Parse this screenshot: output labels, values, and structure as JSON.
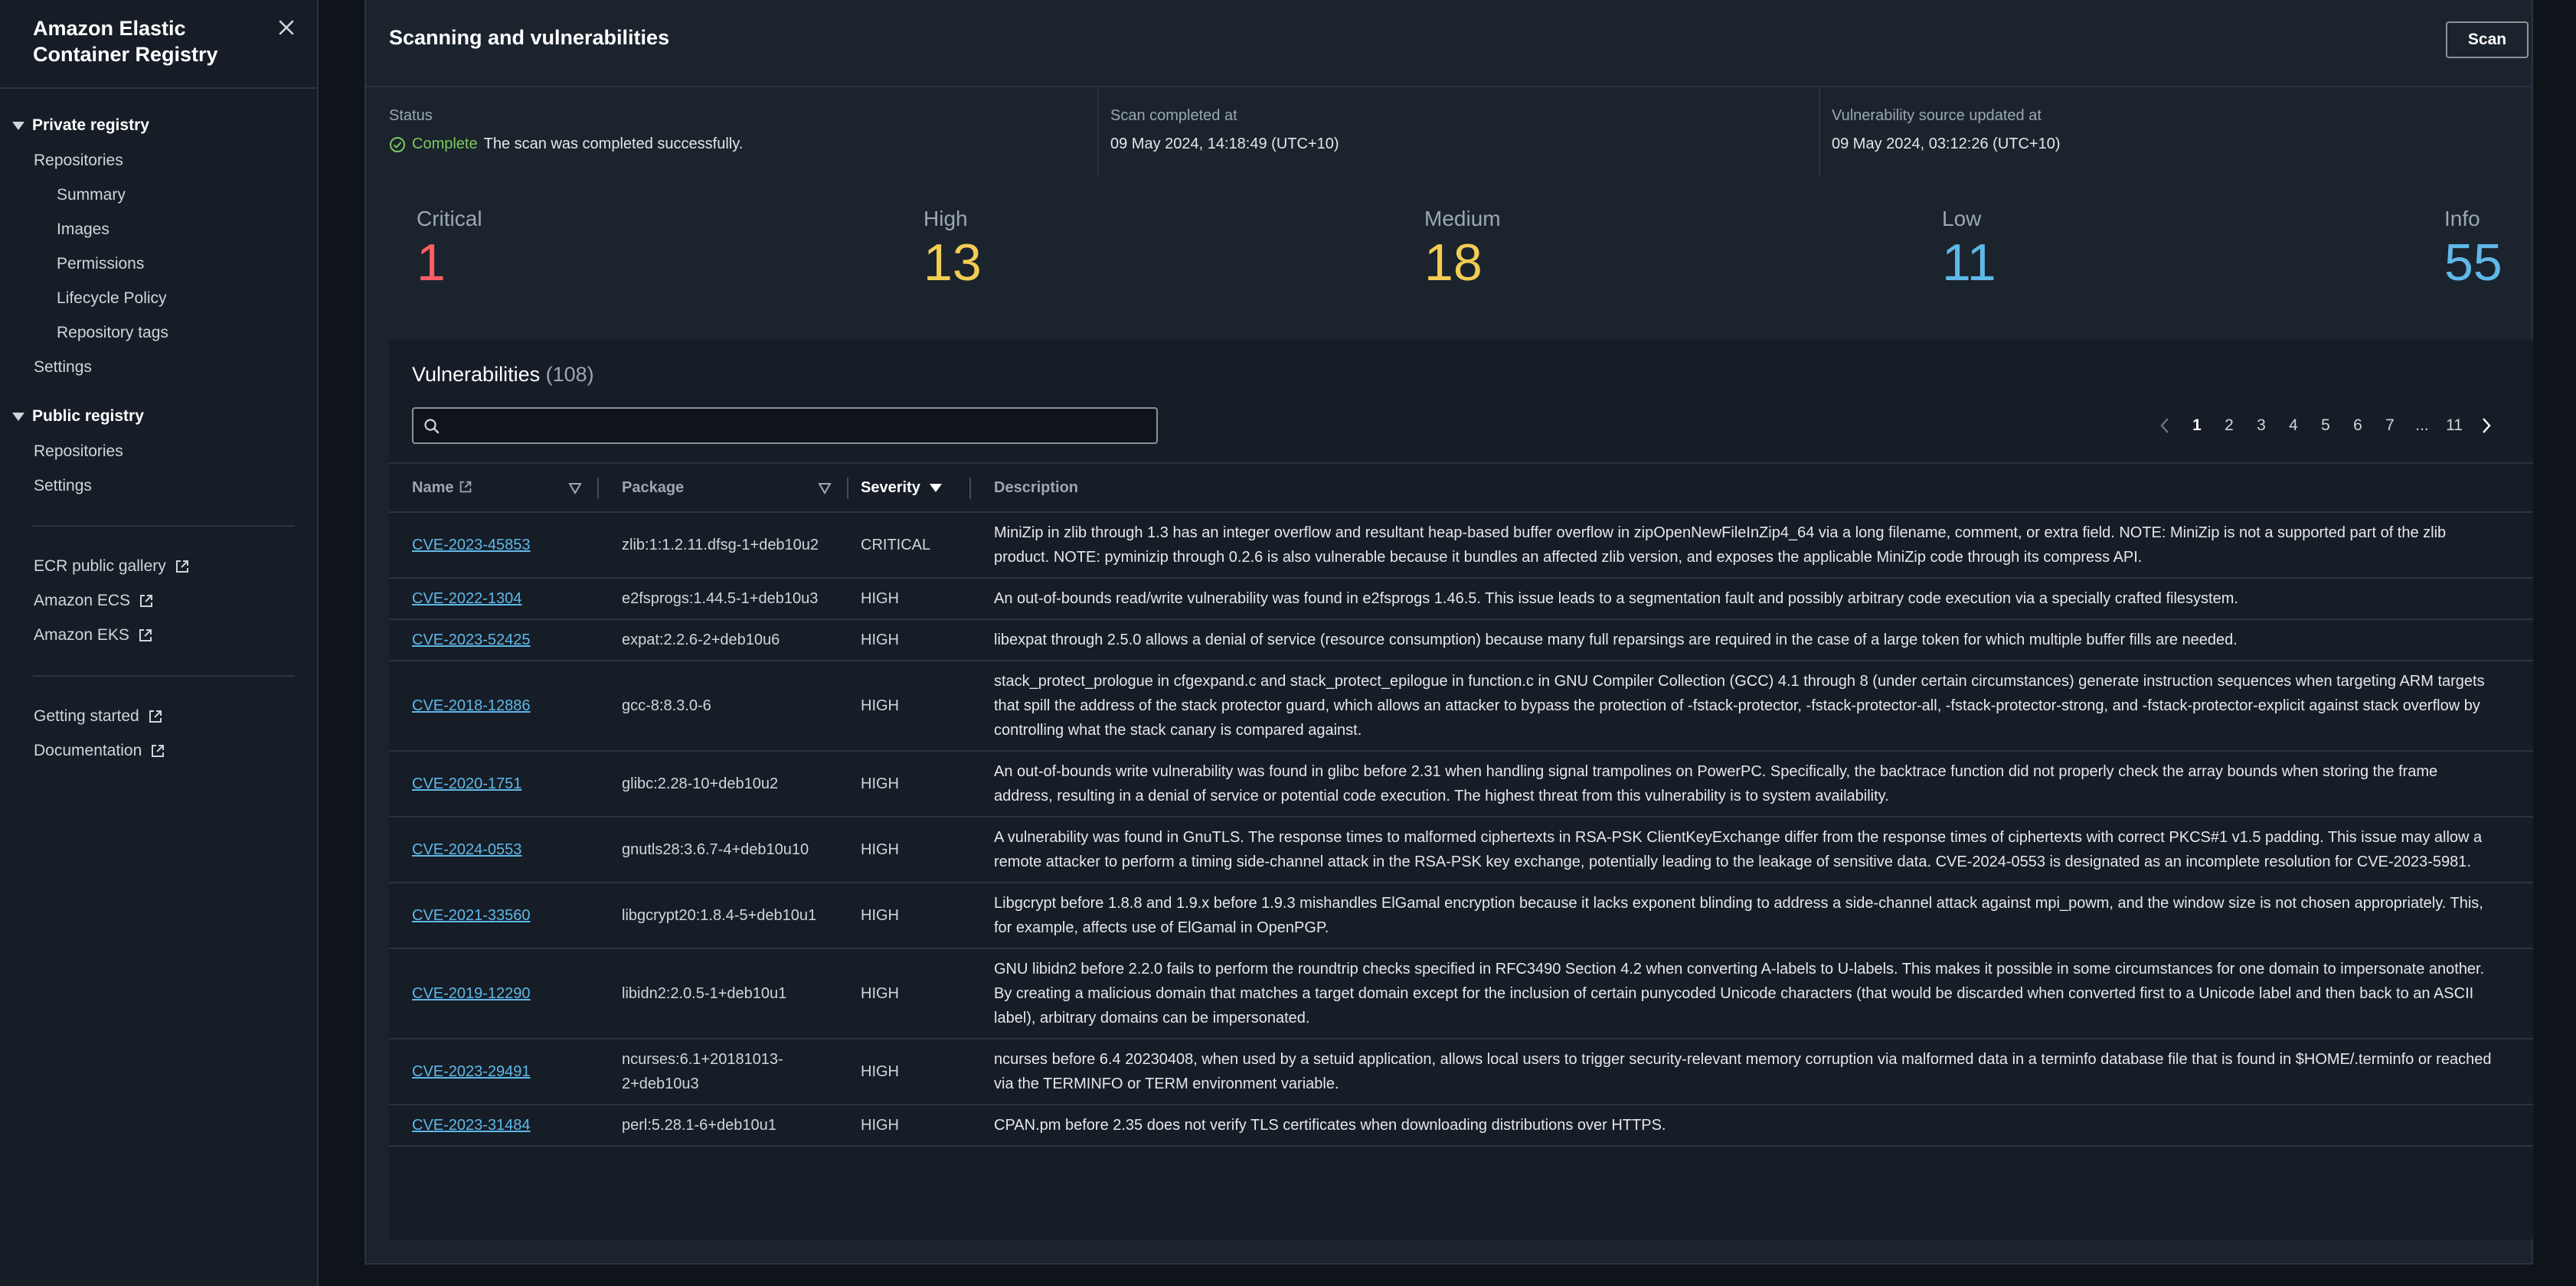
{
  "sidebar": {
    "title": "Amazon Elastic Container Registry",
    "private_registry": {
      "label": "Private registry",
      "items": [
        "Repositories",
        "Summary",
        "Images",
        "Permissions",
        "Lifecycle Policy",
        "Repository tags",
        "Settings"
      ]
    },
    "public_registry": {
      "label": "Public registry",
      "items": [
        "Repositories",
        "Settings"
      ]
    },
    "external_links": [
      "ECR public gallery",
      "Amazon ECS",
      "Amazon EKS"
    ],
    "help_links": [
      "Getting started",
      "Documentation"
    ]
  },
  "panel": {
    "title": "Scanning and vulnerabilities",
    "scan_button": "Scan",
    "status": {
      "label": "Status",
      "value": "Complete",
      "message": "The scan was completed successfully."
    },
    "scan_completed": {
      "label": "Scan completed at",
      "value": "09 May 2024, 14:18:49 (UTC+10)"
    },
    "source_updated": {
      "label": "Vulnerability source updated at",
      "value": "09 May 2024, 03:12:26 (UTC+10)"
    },
    "severity_counts": [
      {
        "label": "Critical",
        "count": "1",
        "color": "#ff5d64"
      },
      {
        "label": "High",
        "count": "13",
        "color": "#f2cd54"
      },
      {
        "label": "Medium",
        "count": "18",
        "color": "#f2cd54"
      },
      {
        "label": "Low",
        "count": "11",
        "color": "#5fb8e8"
      },
      {
        "label": "Info",
        "count": "55",
        "color": "#5fb8e8"
      }
    ]
  },
  "vulnerabilities": {
    "title": "Vulnerabilities",
    "count": "(108)",
    "search_placeholder": "",
    "pagination": {
      "pages": [
        "1",
        "2",
        "3",
        "4",
        "5",
        "6",
        "7",
        "...",
        "11"
      ],
      "current": "1"
    },
    "columns": [
      "Name",
      "Package",
      "Severity",
      "Description"
    ],
    "rows": [
      {
        "name": "CVE-2023-45853",
        "package": "zlib:1:1.2.11.dfsg-1+deb10u2",
        "severity": "CRITICAL",
        "description": "MiniZip in zlib through 1.3 has an integer overflow and resultant heap-based buffer overflow in zipOpenNewFileInZip4_64 via a long filename, comment, or extra field. NOTE: MiniZip is not a supported part of the zlib product. NOTE: pyminizip through 0.2.6 is also vulnerable because it bundles an affected zlib version, and exposes the applicable MiniZip code through its compress API."
      },
      {
        "name": "CVE-2022-1304",
        "package": "e2fsprogs:1.44.5-1+deb10u3",
        "severity": "HIGH",
        "description": "An out-of-bounds read/write vulnerability was found in e2fsprogs 1.46.5. This issue leads to a segmentation fault and possibly arbitrary code execution via a specially crafted filesystem."
      },
      {
        "name": "CVE-2023-52425",
        "package": "expat:2.2.6-2+deb10u6",
        "severity": "HIGH",
        "description": "libexpat through 2.5.0 allows a denial of service (resource consumption) because many full reparsings are required in the case of a large token for which multiple buffer fills are needed."
      },
      {
        "name": "CVE-2018-12886",
        "package": "gcc-8:8.3.0-6",
        "severity": "HIGH",
        "description": "stack_protect_prologue in cfgexpand.c and stack_protect_epilogue in function.c in GNU Compiler Collection (GCC) 4.1 through 8 (under certain circumstances) generate instruction sequences when targeting ARM targets that spill the address of the stack protector guard, which allows an attacker to bypass the protection of -fstack-protector, -fstack-protector-all, -fstack-protector-strong, and -fstack-protector-explicit against stack overflow by controlling what the stack canary is compared against."
      },
      {
        "name": "CVE-2020-1751",
        "package": "glibc:2.28-10+deb10u2",
        "severity": "HIGH",
        "description": "An out-of-bounds write vulnerability was found in glibc before 2.31 when handling signal trampolines on PowerPC. Specifically, the backtrace function did not properly check the array bounds when storing the frame address, resulting in a denial of service or potential code execution. The highest threat from this vulnerability is to system availability."
      },
      {
        "name": "CVE-2024-0553",
        "package": "gnutls28:3.6.7-4+deb10u10",
        "severity": "HIGH",
        "description": "A vulnerability was found in GnuTLS. The response times to malformed ciphertexts in RSA-PSK ClientKeyExchange differ from the response times of ciphertexts with correct PKCS#1 v1.5 padding. This issue may allow a remote attacker to perform a timing side-channel attack in the RSA-PSK key exchange, potentially leading to the leakage of sensitive data. CVE-2024-0553 is designated as an incomplete resolution for CVE-2023-5981."
      },
      {
        "name": "CVE-2021-33560",
        "package": "libgcrypt20:1.8.4-5+deb10u1",
        "severity": "HIGH",
        "description": "Libgcrypt before 1.8.8 and 1.9.x before 1.9.3 mishandles ElGamal encryption because it lacks exponent blinding to address a side-channel attack against mpi_powm, and the window size is not chosen appropriately. This, for example, affects use of ElGamal in OpenPGP."
      },
      {
        "name": "CVE-2019-12290",
        "package": "libidn2:2.0.5-1+deb10u1",
        "severity": "HIGH",
        "description": "GNU libidn2 before 2.2.0 fails to perform the roundtrip checks specified in RFC3490 Section 4.2 when converting A-labels to U-labels. This makes it possible in some circumstances for one domain to impersonate another. By creating a malicious domain that matches a target domain except for the inclusion of certain punycoded Unicode characters (that would be discarded when converted first to a Unicode label and then back to an ASCII label), arbitrary domains can be impersonated."
      },
      {
        "name": "CVE-2023-29491",
        "package": "ncurses:6.1+20181013-2+deb10u3",
        "severity": "HIGH",
        "description": "ncurses before 6.4 20230408, when used by a setuid application, allows local users to trigger security-relevant memory corruption via malformed data in a terminfo database file that is found in $HOME/.terminfo or reached via the TERMINFO or TERM environment variable."
      },
      {
        "name": "CVE-2023-31484",
        "package": "perl:5.28.1-6+deb10u1",
        "severity": "HIGH",
        "description": "CPAN.pm before 2.35 does not verify TLS certificates when downloading distributions over HTTPS."
      }
    ]
  }
}
